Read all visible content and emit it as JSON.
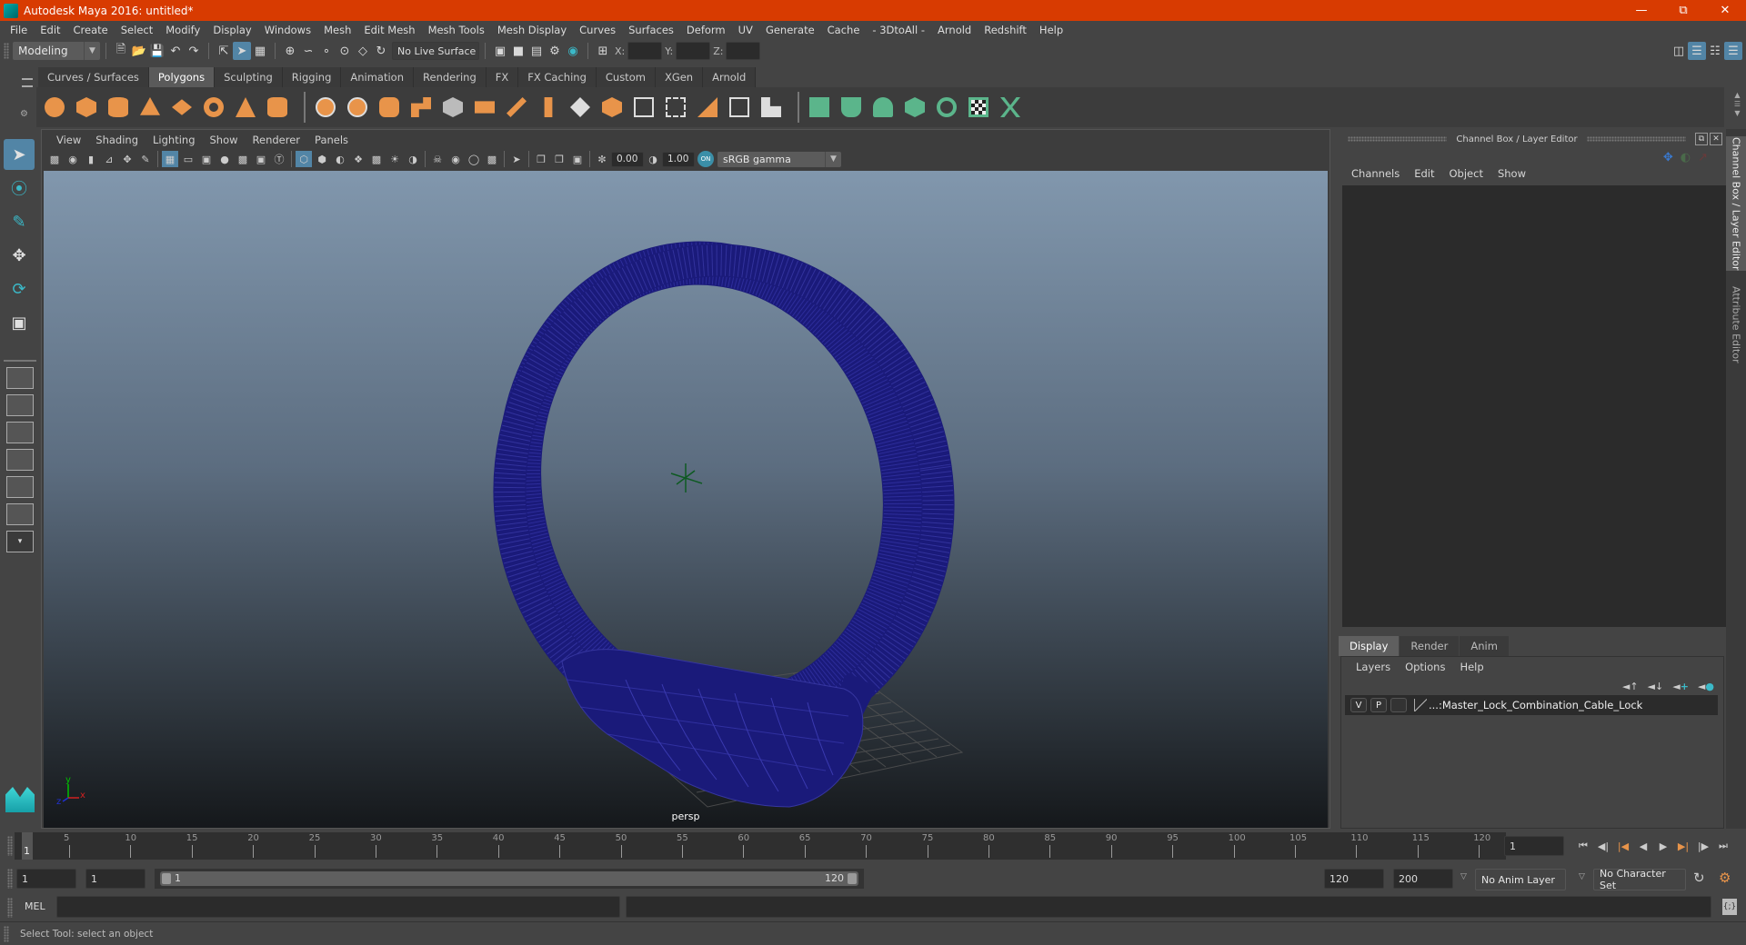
{
  "window": {
    "title": "Autodesk Maya 2016: untitled*",
    "controls": [
      "minimize",
      "restore",
      "close"
    ]
  },
  "menubar": {
    "items": [
      "File",
      "Edit",
      "Create",
      "Select",
      "Modify",
      "Display",
      "Windows",
      "Mesh",
      "Edit Mesh",
      "Mesh Tools",
      "Mesh Display",
      "Curves",
      "Surfaces",
      "Deform",
      "UV",
      "Generate",
      "Cache",
      "- 3DtoAll -",
      "Arnold",
      "Redshift",
      "Help"
    ]
  },
  "statusline": {
    "menuset": "Modeling",
    "live_surface": "No Live Surface",
    "x_label": "X:",
    "y_label": "Y:",
    "z_label": "Z:",
    "x_value": "",
    "y_value": "",
    "z_value": ""
  },
  "shelf": {
    "tabs": [
      "Curves / Surfaces",
      "Polygons",
      "Sculpting",
      "Rigging",
      "Animation",
      "Rendering",
      "FX",
      "FX Caching",
      "Custom",
      "XGen",
      "Arnold"
    ],
    "active_tab": "Polygons"
  },
  "viewport": {
    "menu": [
      "View",
      "Shading",
      "Lighting",
      "Show",
      "Renderer",
      "Panels"
    ],
    "exposure": "0.00",
    "gamma": "1.00",
    "color_space": "sRGB gamma",
    "camera_label": "persp",
    "axis_labels": {
      "x": "x",
      "y": "y",
      "z": "z"
    },
    "wire_color": "#1a1a7a"
  },
  "channel_box": {
    "header": "Channel Box / Layer Editor",
    "menu": [
      "Channels",
      "Edit",
      "Object",
      "Show"
    ]
  },
  "layer_editor": {
    "tabs": [
      "Display",
      "Render",
      "Anim"
    ],
    "active_tab": "Display",
    "menu": [
      "Layers",
      "Options",
      "Help"
    ],
    "layers": [
      {
        "v": "V",
        "p": "P",
        "name": "...:Master_Lock_Combination_Cable_Lock"
      }
    ]
  },
  "side_tabs": [
    "Channel Box / Layer Editor",
    "Attribute Editor"
  ],
  "timeline": {
    "ticks": [
      "5",
      "10",
      "15",
      "20",
      "25",
      "30",
      "35",
      "40",
      "45",
      "50",
      "55",
      "60",
      "65",
      "70",
      "75",
      "80",
      "85",
      "90",
      "95",
      "100",
      "105",
      "110",
      "115",
      "120"
    ],
    "start_label": "1",
    "current_frame": "1"
  },
  "range": {
    "start": "1",
    "playback_start": "1",
    "slider_start": "1",
    "slider_end": "120",
    "playback_end": "120",
    "end": "200",
    "anim_layer": "No Anim Layer",
    "character_set": "No Character Set"
  },
  "command_line": {
    "label": "MEL",
    "value": ""
  },
  "help_line": "Select Tool: select an object",
  "accent": {
    "title_bar": "#d83b01",
    "active_blue": "#5285a6",
    "shelf_orange": "#e8944a",
    "shelf_green": "#5bb58b"
  }
}
